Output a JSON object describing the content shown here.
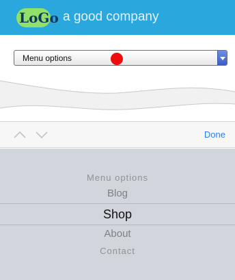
{
  "header": {
    "logo_text": "LoGo",
    "tagline": "a good company"
  },
  "select": {
    "value": "Menu options"
  },
  "picker": {
    "done_label": "Done",
    "options": [
      "Menu options",
      "Blog",
      "Shop",
      "About",
      "Contact"
    ],
    "selected": "Shop"
  },
  "colors": {
    "header_bg": "#2aa7dd",
    "logo_blob": "#8fe16a",
    "logo_text": "#12385f",
    "marker": "#ee0d0d",
    "done": "#2a7ff0"
  }
}
